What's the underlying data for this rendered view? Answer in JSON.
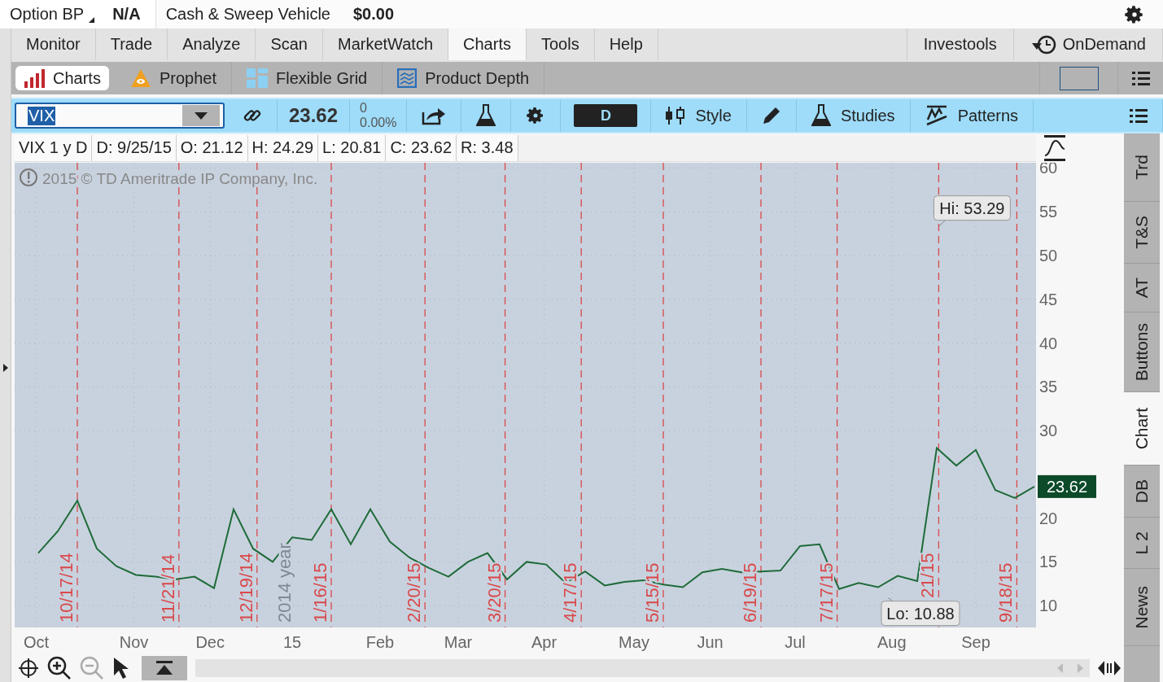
{
  "account_bar": {
    "items": [
      {
        "label": "Option BP",
        "value": "N/A",
        "dropdown": true
      },
      {
        "label": "Cash & Sweep Vehicle",
        "value": "$0.00",
        "dropdown": false
      }
    ]
  },
  "main_tabs": [
    {
      "label": "Monitor",
      "selected": false
    },
    {
      "label": "Trade",
      "selected": false
    },
    {
      "label": "Analyze",
      "selected": false
    },
    {
      "label": "Scan",
      "selected": false
    },
    {
      "label": "MarketWatch",
      "selected": false
    },
    {
      "label": "Charts",
      "selected": true
    },
    {
      "label": "Tools",
      "selected": false
    },
    {
      "label": "Help",
      "selected": false
    }
  ],
  "right_tabs": [
    "Investools",
    "OnDemand"
  ],
  "sub_tabs": [
    {
      "label": "Charts",
      "selected": true
    },
    {
      "label": "Prophet",
      "selected": false
    },
    {
      "label": "Flexible Grid",
      "selected": false
    },
    {
      "label": "Product Depth",
      "selected": false
    }
  ],
  "toolbar": {
    "symbol": "VIX",
    "price": "23.62",
    "change": "0",
    "change_pct": "0.00%",
    "period": "D",
    "buttons": [
      "Style",
      "Studies",
      "Patterns"
    ]
  },
  "info_bar": [
    "VIX 1 y D",
    "D: 9/25/15",
    "O: 21.12",
    "H: 24.29",
    "L: 20.81",
    "C: 23.62",
    "R: 3.48"
  ],
  "chart": {
    "copyright": "2015 © TD Ameritrade IP Company, Inc.",
    "year_label": "2014 year",
    "last_price": "23.62",
    "month_labels": [
      "Oct",
      "Nov",
      "Dec",
      "15",
      "Feb",
      "Mar",
      "Apr",
      "May",
      "Jun",
      "Jul",
      "Aug",
      "Sep"
    ],
    "date_markers": [
      "10/17/14",
      "11/21/14",
      "12/19/14",
      "1/16/15",
      "2/20/15",
      "3/20/15",
      "4/17/15",
      "5/15/15",
      "6/19/15",
      "7/17/15",
      "21/15",
      "9/18/15"
    ],
    "high_label": "Hi: 53.29",
    "low_label": "Lo: 10.88",
    "chart_data": {
      "type": "line",
      "series": [
        {
          "color": "#1f6b3a",
          "values": [
            16,
            18.5,
            22,
            16.5,
            14.5,
            13.5,
            13.3,
            13,
            13.3,
            12,
            21,
            16.5,
            15,
            17.8,
            17.5,
            21,
            17,
            21,
            17.3,
            15.5,
            14.3,
            13.3,
            15,
            16,
            13,
            15,
            14.7,
            12.6,
            13.9,
            12.3,
            12.7,
            12.9,
            12.4,
            12.1,
            13.8,
            14.2,
            13.8,
            13.9,
            14,
            16.8,
            17,
            11.9,
            12.6,
            12.1,
            13.4,
            12.8,
            28,
            26,
            27.8,
            23.2,
            22.3,
            23.6
          ]
        }
      ],
      "ylim": [
        7.5,
        60.6
      ],
      "yticks": [
        10,
        15,
        20,
        30,
        35,
        40,
        45,
        50,
        55,
        60
      ],
      "grid": true
    }
  },
  "side_tabs": [
    {
      "label": "Trd",
      "selected": false
    },
    {
      "label": "T&S",
      "selected": false
    },
    {
      "label": "AT",
      "selected": false
    },
    {
      "label": "Buttons",
      "selected": false
    },
    {
      "label": "Chart",
      "selected": true
    },
    {
      "label": "DB",
      "selected": false
    },
    {
      "label": "L 2",
      "selected": false
    },
    {
      "label": "News",
      "selected": false
    }
  ]
}
